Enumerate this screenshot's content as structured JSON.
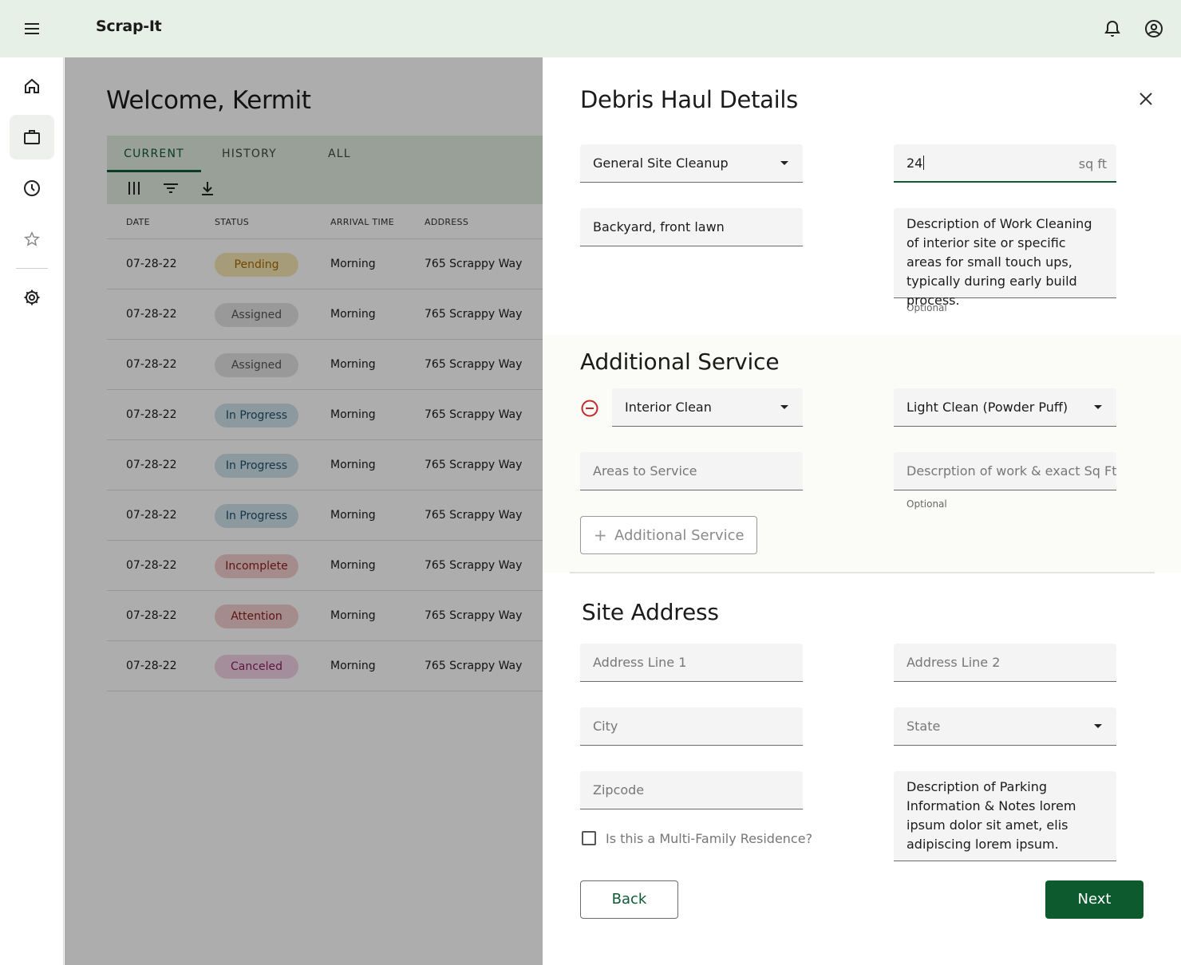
{
  "appbar": {
    "title": "Scrap-It",
    "menu_icon": "menu-icon",
    "bell_icon": "bell-icon",
    "account_icon": "account-icon"
  },
  "rail": {
    "items": [
      "home-icon",
      "briefcase-icon",
      "clock-icon",
      "star-icon",
      "gear-icon"
    ]
  },
  "main": {
    "welcome": "Welcome, Kermit",
    "tabs": [
      {
        "label": "CURRENT"
      },
      {
        "label": "HISTORY"
      },
      {
        "label": "ALL"
      }
    ],
    "columns": [
      "DATE",
      "STATUS",
      "ARRIVAL TIME",
      "ADDRESS"
    ],
    "rows": [
      {
        "date": "07-28-22",
        "status": "Pending",
        "arrival": "Morning",
        "address": "765 Scrappy Way"
      },
      {
        "date": "07-28-22",
        "status": "Assigned",
        "arrival": "Morning",
        "address": "765 Scrappy Way"
      },
      {
        "date": "07-28-22",
        "status": "Assigned",
        "arrival": "Morning",
        "address": "765 Scrappy Way"
      },
      {
        "date": "07-28-22",
        "status": "In Progress",
        "arrival": "Morning",
        "address": "765 Scrappy Way"
      },
      {
        "date": "07-28-22",
        "status": "In Progress",
        "arrival": "Morning",
        "address": "765 Scrappy Way"
      },
      {
        "date": "07-28-22",
        "status": "In Progress",
        "arrival": "Morning",
        "address": "765 Scrappy Way"
      },
      {
        "date": "07-28-22",
        "status": "Incomplete",
        "arrival": "Morning",
        "address": "765 Scrappy Way"
      },
      {
        "date": "07-28-22",
        "status": "Attention",
        "arrival": "Morning",
        "address": "765 Scrappy Way"
      },
      {
        "date": "07-28-22",
        "status": "Canceled",
        "arrival": "Morning",
        "address": "765 Scrappy Way"
      }
    ],
    "status_colors": {
      "Pending": {
        "bg": "#f6e6b4",
        "fg": "#a66b00"
      },
      "Assigned": {
        "bg": "#e2e2e2",
        "fg": "#555555"
      },
      "In Progress": {
        "bg": "#cfe2ea",
        "fg": "#1f4f6b"
      },
      "Incomplete": {
        "bg": "#f3cfcf",
        "fg": "#8c1c1c"
      },
      "Attention": {
        "bg": "#f3cfcf",
        "fg": "#8c1c1c"
      },
      "Canceled": {
        "bg": "#f3d2e6",
        "fg": "#8a1f62"
      }
    }
  },
  "drawer": {
    "title": "Debris Haul Details",
    "service_type": "General Site Cleanup",
    "sq_ft_value": "24",
    "sq_ft_suffix": "sq ft",
    "areas": "Backyard, front lawn",
    "description": "Description of Work Cleaning of interior site or specific areas for small touch ups, typically during early build process.",
    "description_helper": "Optional",
    "additional": {
      "heading": "Additional Service",
      "service": "Interior Clean",
      "level": "Light Clean (Powder Puff)",
      "areas_placeholder": "Areas to Service",
      "desc_placeholder": "Descrption of work & exact Sq Ft",
      "desc_helper": "Optional",
      "add_label": "Additional Service"
    },
    "site": {
      "heading": "Site Address",
      "line1": "Address Line 1",
      "line2": "Address Line 2",
      "city": "City",
      "state": "State",
      "zip": "Zipcode",
      "notes": "Description of Parking Information & Notes lorem ipsum dolor sit amet, elis adipiscing lorem ipsum.",
      "multi_family": "Is this a Multi-Family Residence?"
    },
    "back": "Back",
    "next": "Next"
  },
  "colors": {
    "appbar": "#e6f0e6",
    "primary": "#0d5a2f",
    "scrim": "rgba(0,0,0,0.32)"
  }
}
